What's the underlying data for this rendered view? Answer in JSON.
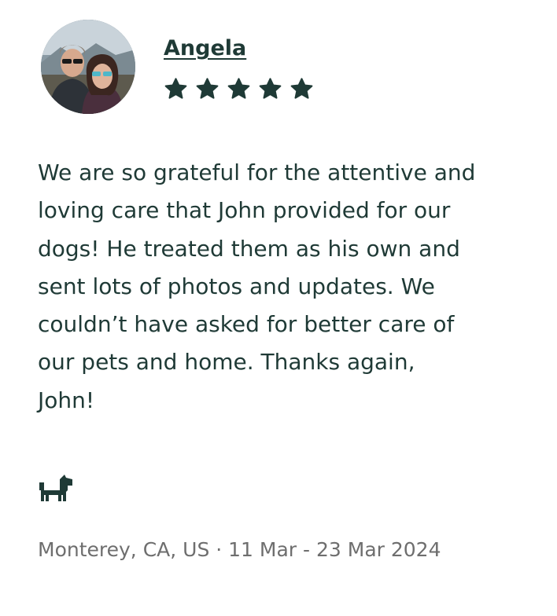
{
  "review": {
    "reviewer_name": "Angela",
    "rating": 5,
    "rating_max": 5,
    "text": "We are so grateful for the attentive and loving care that John provided for our dogs! He treated them as his own and sent lots of photos and updates. We couldn’t have asked for better care of our pets and home. Thanks again, John!",
    "service_icon": "dog-icon",
    "location": "Monterey, CA, US",
    "date_range": "11 Mar - 23 Mar 2024",
    "separator": " · "
  },
  "colors": {
    "primary": "#1f3a36",
    "meta": "#6e6e6e",
    "background": "#ffffff"
  }
}
